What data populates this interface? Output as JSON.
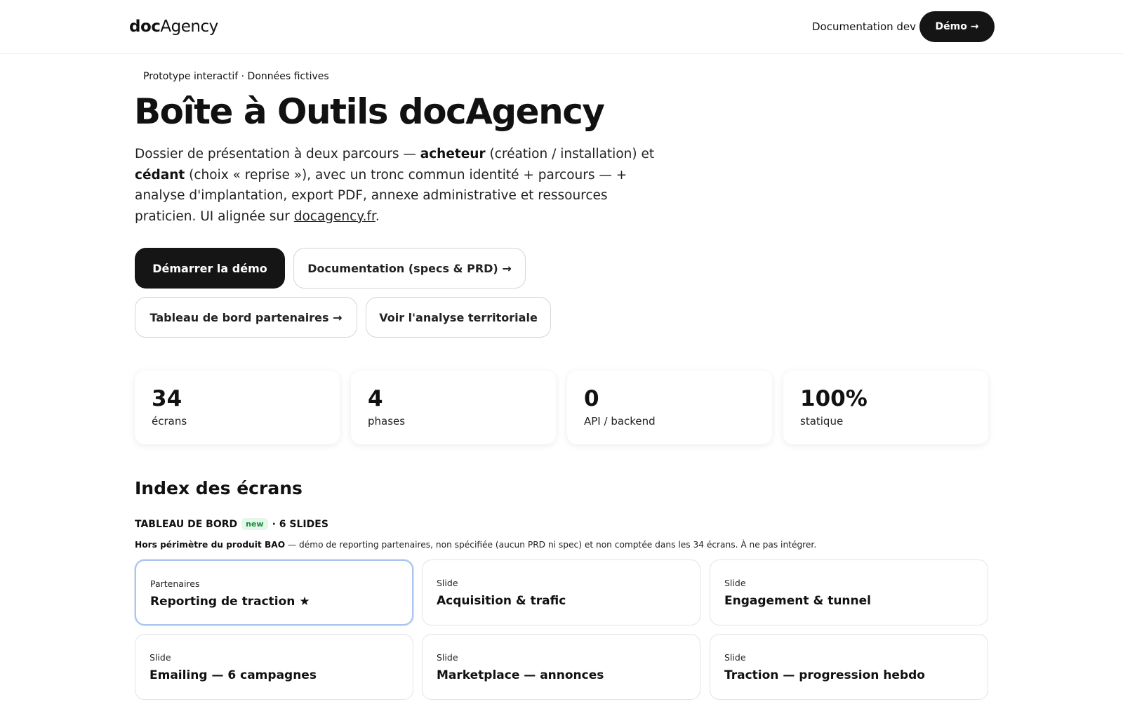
{
  "header": {
    "logo_bold": "doc",
    "logo_regular": "Agency",
    "nav_doc_label": "Documentation dev",
    "demo_button_label": "Démo →"
  },
  "hero": {
    "eyebrow": "Prototype interactif · Données fictives",
    "title": "Boîte à Outils docAgency",
    "lead_part1": "Dossier de présentation à deux parcours — ",
    "lead_bold1": "acheteur",
    "lead_part2": " (création / installation) et ",
    "lead_bold2": "cédant",
    "lead_part3": " (choix « reprise »), avec un tronc commun identité + parcours — + analyse d'implantation, export PDF, annexe administrative et ressources praticien. UI alignée sur ",
    "lead_link": "docagency.fr",
    "lead_end": ".",
    "buttons": {
      "start_demo": "Démarrer la démo",
      "docs": "Documentation (specs & PRD) →",
      "partners": "Tableau de bord partenaires →",
      "territorial": "Voir l'analyse territoriale"
    }
  },
  "stats": [
    {
      "value": "34",
      "label": "écrans"
    },
    {
      "value": "4",
      "label": "phases"
    },
    {
      "value": "0",
      "label": "API / backend"
    },
    {
      "value": "100%",
      "label": "statique"
    }
  ],
  "index": {
    "title": "Index des écrans",
    "group": {
      "name": "TABLEAU DE BORD",
      "badge": "new",
      "count": "· 6 SLIDES",
      "note_bold": "Hors périmètre du produit BAO",
      "note_rest": " — démo de reporting partenaires, non spécifiée (aucun PRD ni spec) et non comptée dans les 34 écrans. À ne pas intégrer.",
      "cards": [
        {
          "kicker": "Partenaires",
          "name": "Reporting de traction ★"
        },
        {
          "kicker": "Slide",
          "name": "Acquisition & trafic"
        },
        {
          "kicker": "Slide",
          "name": "Engagement & tunnel"
        },
        {
          "kicker": "Slide",
          "name": "Emailing — 6 campagnes"
        },
        {
          "kicker": "Slide",
          "name": "Marketplace — annonces"
        },
        {
          "kicker": "Slide",
          "name": "Traction — progression hebdo"
        }
      ]
    }
  },
  "colors": {
    "primary_dark": "#151515",
    "active_card_border": "#a9c4ee",
    "badge_bg": "#e4f7ea",
    "badge_text": "#1a8a3c"
  }
}
